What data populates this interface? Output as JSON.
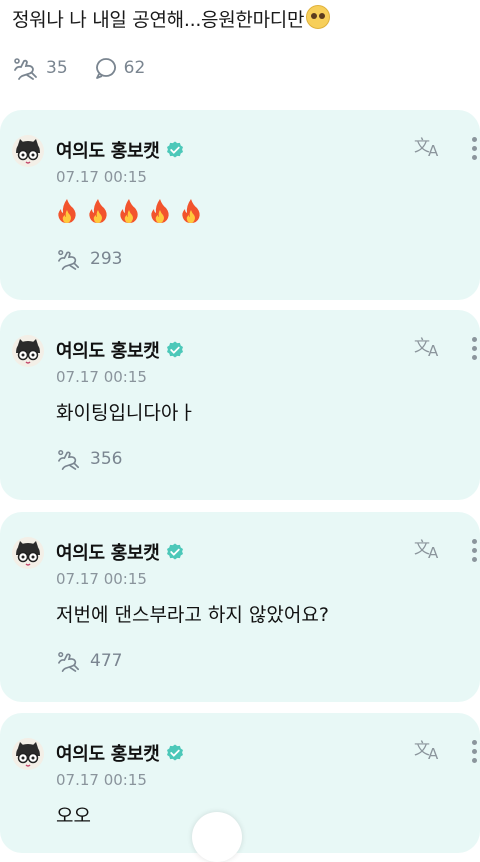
{
  "post": {
    "text": "정워나 나 내일 공연해...응원한마디만",
    "like_count": "35",
    "comment_count": "62"
  },
  "comments": [
    {
      "author": "여의도 홍보캣",
      "time": "07.17 00:15",
      "text": "🔥🔥🔥🔥🔥",
      "likes": "293",
      "is_emoji": true
    },
    {
      "author": "여의도 홍보캣",
      "time": "07.17 00:15",
      "text": "화이팅입니다아ㅏ",
      "likes": "356"
    },
    {
      "author": "여의도 홍보캣",
      "time": "07.17 00:15",
      "text": "저번에 댄스부라고 하지 않았어요?",
      "likes": "477"
    },
    {
      "author": "여의도 홍보캣",
      "time": "07.17 00:15",
      "text": "오오"
    }
  ],
  "colors": {
    "card_bg": "#e8f8f6",
    "verified_badge": "#4cc8b9",
    "meta_gray": "#8a949c"
  },
  "icons": {
    "like": "paw-like-icon",
    "comment": "comment-bubble-icon",
    "translate": "translate-icon",
    "more": "more-vertical-icon",
    "verified": "verified-badge-icon"
  }
}
